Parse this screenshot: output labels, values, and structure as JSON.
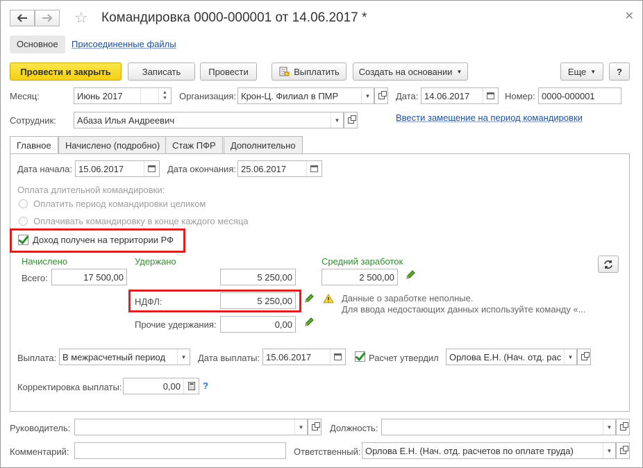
{
  "window": {
    "title": "Командировка 0000-000001 от 14.06.2017 *",
    "back_icon": "arrow-left-icon",
    "forward_icon": "arrow-right-icon",
    "star_icon": "star-icon",
    "close_icon": "close-icon"
  },
  "top_tabs": [
    {
      "label": "Основное"
    },
    {
      "label": "Присоединенные файлы"
    }
  ],
  "toolbar": {
    "post_close": "Провести и закрыть",
    "save": "Записать",
    "post": "Провести",
    "pay": "Выплатить",
    "create_basis": "Создать на основании",
    "more": "Еще",
    "help": "?"
  },
  "header": {
    "month_label": "Месяц:",
    "month_value": "Июнь 2017",
    "org_label": "Организация:",
    "org_value": "Крон-Ц. Филиал в ПМР",
    "date_label": "Дата:",
    "date_value": "14.06.2017",
    "number_label": "Номер:",
    "number_value": "0000-000001",
    "employee_label": "Сотрудник:",
    "employee_value": "Абаза Илья Андреевич",
    "replacement_link": "Ввести замещение на период командировки"
  },
  "tabs": [
    {
      "label": "Главное"
    },
    {
      "label": "Начислено (подробно)"
    },
    {
      "label": "Стаж ПФР"
    },
    {
      "label": "Дополнительно"
    }
  ],
  "main": {
    "start_label": "Дата начала:",
    "start_value": "15.06.2017",
    "end_label": "Дата окончания:",
    "end_value": "25.06.2017",
    "long_trip_label": "Оплата длительной командировки:",
    "radio_whole": "Оплатить период командировки целиком",
    "radio_monthly": "Оплачивать командировку в конце каждого месяца",
    "income_rf_label": "Доход получен на территории РФ",
    "accrued_header": "Начислено",
    "withheld_header": "Удержано",
    "avg_header": "Средний заработок",
    "total_label": "Всего:",
    "accrued_total": "17 500,00",
    "withheld_total": "5 250,00",
    "avg_value": "2 500,00",
    "ndfl_label": "НДФЛ:",
    "ndfl_value": "5 250,00",
    "other_label": "Прочие удержания:",
    "other_value": "0,00",
    "warning_line1": "Данные о заработке неполные.",
    "warning_line2": "Для ввода недостающих данных используйте команду «...",
    "payout_label": "Выплата:",
    "payout_value": "В межрасчетный период",
    "payout_date_label": "Дата выплаты:",
    "payout_date_value": "15.06.2017",
    "approved_label": "Расчет утвердил",
    "approved_value": "Орлова Е.Н. (Нач. отд. рас",
    "correction_label": "Корректировка выплаты:",
    "correction_value": "0,00",
    "help_mark": "?"
  },
  "footer": {
    "manager_label": "Руководитель:",
    "manager_value": "",
    "position_label": "Должность:",
    "position_value": "",
    "comment_label": "Комментарий:",
    "comment_value": "",
    "responsible_label": "Ответственный:",
    "responsible_value": "Орлова Е.Н. (Нач. отд. расчетов по оплате труда)"
  }
}
